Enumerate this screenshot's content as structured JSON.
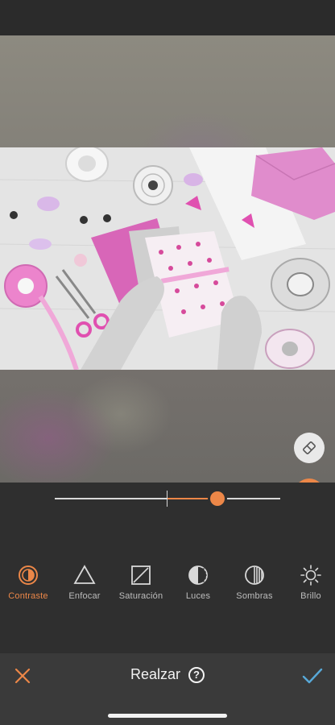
{
  "editor": {
    "tools": [
      {
        "label": "Contraste",
        "icon": "contrast-icon",
        "active": true
      },
      {
        "label": "Enfocar",
        "icon": "sharpen-triangle-icon",
        "active": false
      },
      {
        "label": "Saturación",
        "icon": "saturation-square-icon",
        "active": false
      },
      {
        "label": "Luces",
        "icon": "highlights-icon",
        "active": false
      },
      {
        "label": "Sombras",
        "icon": "shadows-icon",
        "active": false
      },
      {
        "label": "Brillo",
        "icon": "brightness-sun-icon",
        "active": false
      }
    ],
    "slider": {
      "min": -100,
      "max": 100,
      "value": 44
    },
    "floating_buttons": [
      "eraser-icon",
      "compare-icon"
    ]
  },
  "bottom_bar": {
    "title": "Realzar",
    "help_icon": "?",
    "cancel_icon": "close-x-icon",
    "confirm_icon": "checkmark-icon"
  },
  "colors": {
    "accent": "#ec8748",
    "confirm": "#58a9d8",
    "background": "#2f2f2f",
    "bottom_bar": "#3a3a3a"
  }
}
